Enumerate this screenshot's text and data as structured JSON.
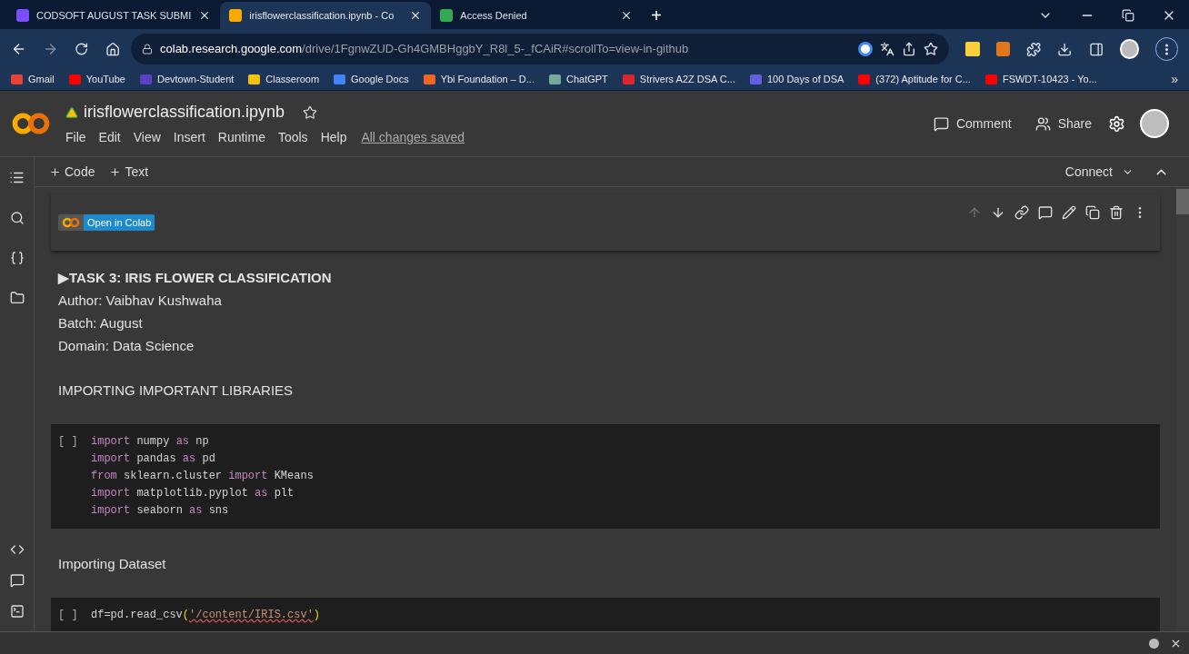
{
  "browser": {
    "tabs": [
      {
        "title": "CODSOFT AUGUST TASK SUBMI",
        "selected": false,
        "color": "#7c4dff"
      },
      {
        "title": "irisflowerclassification.ipynb - Co",
        "selected": true,
        "color": "#f9ab00"
      },
      {
        "title": "Access Denied",
        "selected": false,
        "color": "#34a853"
      }
    ],
    "new_tab": "+",
    "address": {
      "host": "colab.research.google.com",
      "path": "/drive/1FgnwZUD-Gh4GMBHggbY_R8l_5-_fCAiR#scrollTo=view-in-github"
    },
    "bookmarks": [
      {
        "label": "Gmail",
        "color": "#ea4335"
      },
      {
        "label": "YouTube",
        "color": "#ff0000"
      },
      {
        "label": "Devtown-Student",
        "color": "#5b3fc4"
      },
      {
        "label": "Classeroom",
        "color": "#f4c20d"
      },
      {
        "label": "Google Docs",
        "color": "#4285f4"
      },
      {
        "label": "Ybi Foundation – D...",
        "color": "#f26522"
      },
      {
        "label": "ChatGPT",
        "color": "#74aa9c"
      },
      {
        "label": "Strivers A2Z DSA C...",
        "color": "#e0232e"
      },
      {
        "label": "100 Days of DSA",
        "color": "#6060e0"
      },
      {
        "label": "(372) Aptitude for C...",
        "color": "#ff0000"
      },
      {
        "label": "FSWDT-10423 - Yo...",
        "color": "#ff0000"
      }
    ],
    "bookmarks_more": "»"
  },
  "colab": {
    "file_name": "irisflowerclassification.ipynb",
    "menu": [
      "File",
      "Edit",
      "View",
      "Insert",
      "Runtime",
      "Tools",
      "Help"
    ],
    "save_status": "All changes saved",
    "comment": "Comment",
    "share": "Share",
    "add_code": "Code",
    "add_text": "Text",
    "connect": "Connect"
  },
  "cells": [
    {
      "kind": "badge",
      "label": "Open in Colab",
      "selected": true
    },
    {
      "kind": "markdown",
      "selected": false,
      "lines": [
        {
          "text": "▶TASK 3: IRIS FLOWER CLASSIFICATION",
          "bold": true
        },
        {
          "text": "Author: Vaibhav Kushwaha",
          "bold": false
        },
        {
          "text": "Batch: August",
          "bold": false
        },
        {
          "text": "Domain: Data Science",
          "bold": false
        }
      ]
    },
    {
      "kind": "heading",
      "selected": false,
      "text": "IMPORTING IMPORTANT LIBRARIES"
    },
    {
      "kind": "code",
      "selected": false,
      "prompt": "[ ]",
      "lines": [
        [
          {
            "text": "import",
            "kind": "keyword"
          },
          {
            "text": " numpy ",
            "kind": "name"
          },
          {
            "text": "as",
            "kind": "keyword"
          },
          {
            "text": " np",
            "kind": "name"
          }
        ],
        [
          {
            "text": "import",
            "kind": "keyword"
          },
          {
            "text": " pandas ",
            "kind": "name"
          },
          {
            "text": "as",
            "kind": "keyword"
          },
          {
            "text": " pd",
            "kind": "name"
          }
        ],
        [
          {
            "text": "from",
            "kind": "keyword"
          },
          {
            "text": " sklearn.cluster ",
            "kind": "name"
          },
          {
            "text": "import",
            "kind": "keyword"
          },
          {
            "text": " KMeans",
            "kind": "name"
          }
        ],
        [
          {
            "text": "import",
            "kind": "keyword"
          },
          {
            "text": " matplotlib.pyplot ",
            "kind": "name"
          },
          {
            "text": "as",
            "kind": "keyword"
          },
          {
            "text": " plt",
            "kind": "name"
          }
        ],
        [
          {
            "text": "import",
            "kind": "keyword"
          },
          {
            "text": " seaborn ",
            "kind": "name"
          },
          {
            "text": "as",
            "kind": "keyword"
          },
          {
            "text": " sns",
            "kind": "name"
          }
        ]
      ]
    },
    {
      "kind": "heading",
      "selected": false,
      "text": "Importing Dataset"
    },
    {
      "kind": "code",
      "selected": false,
      "prompt": "[ ]",
      "lines": [
        [
          {
            "text": "df=pd.read_csv",
            "kind": "name"
          },
          {
            "text": "(",
            "kind": "paren"
          },
          {
            "text": "'/content/IRIS.csv'",
            "kind": "string"
          },
          {
            "text": ")",
            "kind": "paren"
          }
        ]
      ]
    }
  ]
}
